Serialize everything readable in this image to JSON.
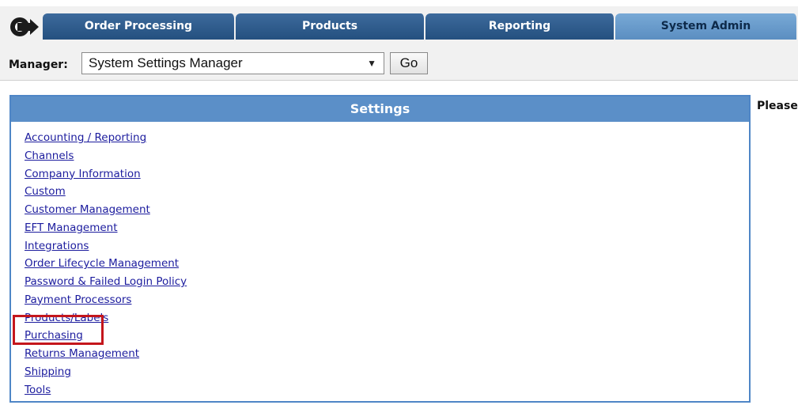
{
  "tabs": [
    {
      "label": "Order Processing"
    },
    {
      "label": "Products"
    },
    {
      "label": "Reporting"
    },
    {
      "label": "System Admin"
    }
  ],
  "active_tab": "System Admin",
  "manager": {
    "label": "Manager:",
    "selected": "System Settings Manager",
    "arrow": "▼",
    "go_label": "Go"
  },
  "settings": {
    "title": "Settings",
    "items": [
      {
        "label": "Accounting / Reporting"
      },
      {
        "label": "Channels"
      },
      {
        "label": "Company Information"
      },
      {
        "label": "Custom"
      },
      {
        "label": "Customer Management"
      },
      {
        "label": "EFT Management"
      },
      {
        "label": "Integrations"
      },
      {
        "label": "Order Lifecycle Management"
      },
      {
        "label": "Password & Failed Login Policy"
      },
      {
        "label": "Payment Processors"
      },
      {
        "label": "Products/Labels"
      },
      {
        "label": "Purchasing"
      },
      {
        "label": "Returns Management"
      },
      {
        "label": "Shipping"
      },
      {
        "label": "Tools"
      }
    ],
    "highlighted_item": "Purchasing"
  },
  "side_text": "Please",
  "colors": {
    "tab_dark": "#24507f",
    "tab_active": "#5b8ec1",
    "panel_header": "#5b8fc8",
    "link": "#1c1c9e",
    "highlight": "#c4161c"
  },
  "icons": {
    "logo": "arrow-logo-icon",
    "dropdown": "chevron-down-icon"
  }
}
